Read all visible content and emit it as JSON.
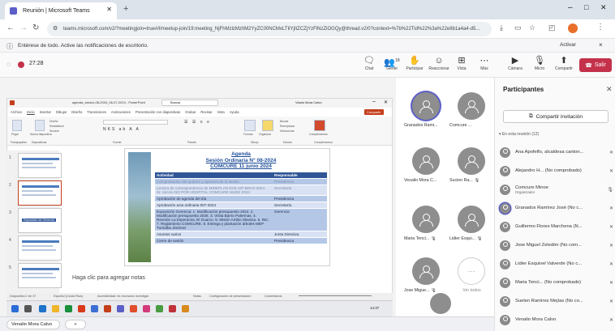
{
  "browser": {
    "tab_title": "Reunión | Microsoft Teams",
    "url": "teams.microsoft.com/v2/?meetingjoin=true#/l/meetup-join/19:meeting_NjFhMzlzMzItM2YyZC00NCMxLTIiYjItZCZjYzFlNzZiOGQy@thread.v2/0?context=%7b%22Tid%22%3a%22e8b1a4a4-d5..."
  },
  "notification": {
    "text": "Entérese de todo. Active las notificaciones de escritorio.",
    "activate": "Activar",
    "close": "×"
  },
  "meeting": {
    "timer": "27:28",
    "toolbar": [
      {
        "icon": "chat-icon",
        "label": "Chat"
      },
      {
        "icon": "people-icon",
        "label": "Gente",
        "count": "18"
      },
      {
        "icon": "raise-hand-icon",
        "label": "Participar"
      },
      {
        "icon": "react-icon",
        "label": "Reaccionar"
      },
      {
        "icon": "view-icon",
        "label": "Vista"
      },
      {
        "icon": "more-icon",
        "label": "Más"
      }
    ],
    "camera": "Cámara",
    "mic": "Micro",
    "share": "Compartir",
    "leave": "Salir"
  },
  "ppt": {
    "title": "agenda_sesion-08-2024_06-07-2024 - PowerPoint",
    "search": "Buscar",
    "user": "Vianio Mora Calvo",
    "share_btn": "Compartir",
    "menu": [
      "Archivo",
      "Inicio",
      "Insertar",
      "Dibujar",
      "Diseño",
      "Transiciones",
      "Animaciones",
      "Presentación con diapositivas",
      "Grabar",
      "Revisar",
      "Vista",
      "Ayuda"
    ],
    "groups": [
      "Portapapeles",
      "Diapositivas",
      "Fuente",
      "Párrafo",
      "Dibujo",
      "Edición",
      "Complementos"
    ],
    "ribbon": {
      "paste": "Pegar",
      "new_slide": "Nueva diapositiva",
      "layout": "Diseño",
      "reset": "Restablecer",
      "sections": "Sección",
      "search": "Buscar",
      "replace": "Reemplazar",
      "select": "Seleccionar",
      "addins": "Complementos",
      "shapes": "Formas",
      "arrange": "Organizar",
      "styles": "Estilos rápidos"
    },
    "notes_placeholder": "Haga clic para agregar notas",
    "status": {
      "slide": "Diapositiva 2 de 37",
      "lang": "Español (Costa Rica)",
      "access": "Accesibilidad: es necesario investigar",
      "notes": "Notas",
      "display": "Configuración de presentación",
      "comments": "Comentarios"
    },
    "taskbar_time": "14:37"
  },
  "slide": {
    "title1": "Agenda",
    "title2": "Sesión Ordinaria N° 08-2024",
    "title3": "COMCURE 11 junio 2024",
    "col1": "Actividad",
    "col2": "Responsable",
    "rows": [
      {
        "a": "Comprobación del quórum y apertura de la sesión",
        "r": "Presidencia"
      },
      {
        "a": "Lectura de correspondencia de MIDEPLAN DVIL-DF-BRAS-2024. Sr. Vecino NO POR HOSPITAL COMCURE MUDE 2024",
        "r": "Secretaría"
      },
      {
        "a": "Aprobación de agenda del día",
        "r": "Presidencia"
      },
      {
        "a": "Aprobación acta ordinaria 007-2024",
        "r": "Secretaría"
      },
      {
        "a": "Exposición Gerencia: 1. Modificación presupuesto 2024. 2. Modificación presupuesto 2025. 3. Visita Barrio Palermas. 4. Reunión La Esperanza, El Guarco. 5. Misión Ambio Slavicta. 6. INC. 7. Reglamento COMCURE. 8. Entrega y plantación árboles MEP Turrialba Jiménez",
        "r": "Gerencia"
      },
      {
        "a": "Asuntos varios",
        "r": "Junta Directiva"
      },
      {
        "a": "Cierre de sesión",
        "r": "Presidencia"
      }
    ]
  },
  "thumbnails": {
    "selected_caption": "Exposición de Gerencia"
  },
  "grid": [
    {
      "name": "Granados Rami...",
      "mic": false
    },
    {
      "name": "Comcure ...",
      "mic": false
    },
    {
      "name": "Vesalio Mora C...",
      "mic": false
    },
    {
      "name": "Sucien Ra...",
      "mic": true
    },
    {
      "name": "Maria Tenci...",
      "mic": true
    },
    {
      "name": "Lidier Esqui...",
      "mic": true
    },
    {
      "name": "Jose Migue...",
      "mic": true
    },
    {
      "name": "Ver todos",
      "mic": false
    }
  ],
  "grid_self": "Venalio Mora Calvo",
  "panel": {
    "title": "Participantes",
    "share_invite": "Compartir invitación",
    "section": "En esta reunión (12)",
    "people": [
      {
        "name": "Ana Apofelfo, alcaldesa canton...",
        "role": ""
      },
      {
        "name": "Alejandro H... (No comprobado)",
        "role": ""
      },
      {
        "name": "Comcure Minoe",
        "role": "Organizador"
      },
      {
        "name": "Granados Ramírez José (No c...",
        "role": ""
      },
      {
        "name": "Guillermo Flores Marchena (N...",
        "role": ""
      },
      {
        "name": "Jose Miguel Zeledón (No com...",
        "role": ""
      },
      {
        "name": "Lidier Esquivel Valverde (No c...",
        "role": ""
      },
      {
        "name": "Maria Tenci... (No comprobado)",
        "role": ""
      },
      {
        "name": "Suelen Ramírez Mejías (No co...",
        "role": ""
      },
      {
        "name": "Venalio Mora Calvo",
        "role": ""
      }
    ]
  },
  "bottom": {
    "user": "Venalio Mora Calvo",
    "add": "+"
  },
  "colors": {
    "accent": "#5b5fc7",
    "leave": "#c4314b",
    "table_header": "#2f5597",
    "table_row": "#8eaadb",
    "slide_title": "#1f4e9a"
  }
}
